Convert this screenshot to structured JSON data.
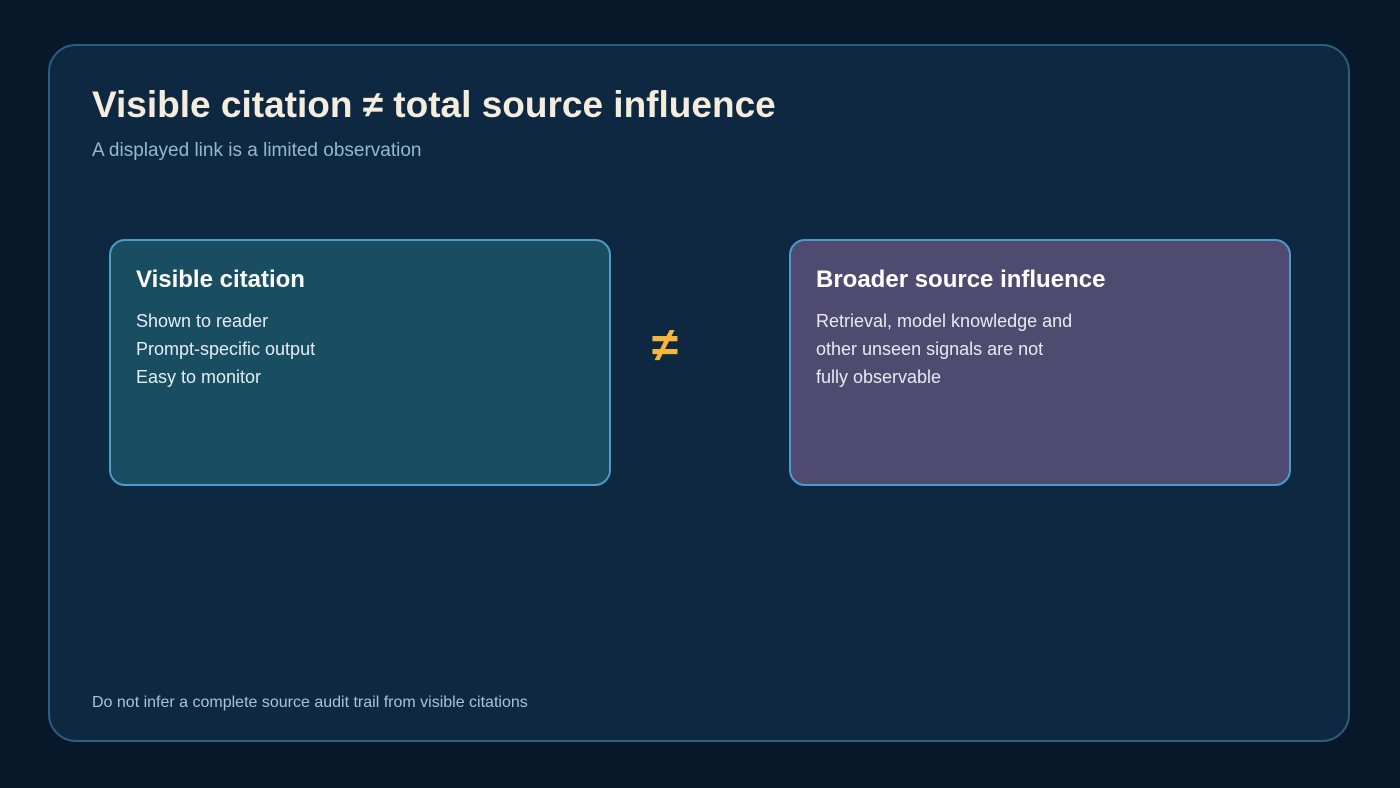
{
  "slide": {
    "title": "Visible citation ≠ total source influence",
    "subtitle": "A displayed link is a limited observation",
    "footer": "Do not infer a complete source audit trail from visible citations"
  },
  "comparison": {
    "operator": "≠",
    "left": {
      "title": "Visible citation",
      "lines": [
        "Shown to reader",
        "Prompt-specific output",
        "Easy to monitor"
      ]
    },
    "right": {
      "title": "Broader source influence",
      "lines": [
        "Retrieval, model knowledge and",
        "other unseen signals are not",
        "fully observable"
      ]
    }
  },
  "colors": {
    "background": "#07182a",
    "panel": "#0d2840",
    "accent": "#f6b53b",
    "left_card": "#194d62",
    "right_card": "#4f4a6f",
    "card_border": "#4c9cc8"
  }
}
